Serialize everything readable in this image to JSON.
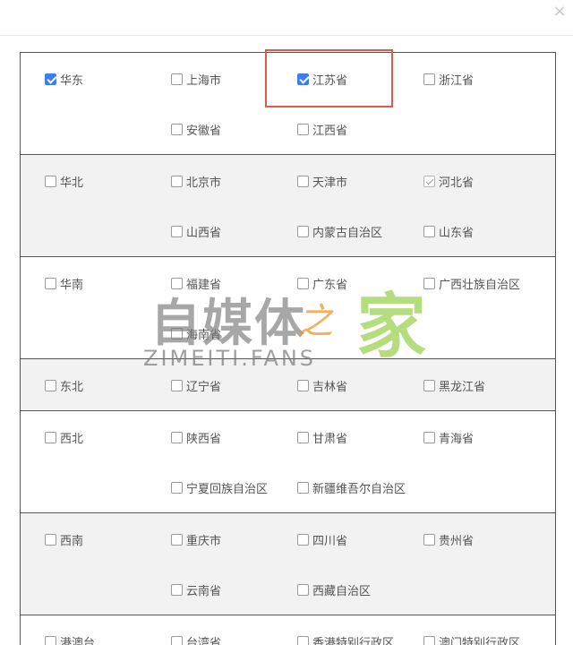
{
  "dialog": {
    "close_symbol": "×"
  },
  "regions": [
    {
      "name": "华东",
      "state": "checked",
      "provinces": [
        {
          "name": "上海市",
          "state": "unchecked"
        },
        {
          "name": "江苏省",
          "state": "checked"
        },
        {
          "name": "浙江省",
          "state": "unchecked"
        },
        {
          "name": "安徽省",
          "state": "unchecked"
        },
        {
          "name": "江西省",
          "state": "unchecked"
        }
      ]
    },
    {
      "name": "华北",
      "state": "unchecked",
      "provinces": [
        {
          "name": "北京市",
          "state": "unchecked"
        },
        {
          "name": "天津市",
          "state": "unchecked"
        },
        {
          "name": "河北省",
          "state": "partial"
        },
        {
          "name": "山西省",
          "state": "unchecked"
        },
        {
          "name": "内蒙古自治区",
          "state": "unchecked"
        },
        {
          "name": "山东省",
          "state": "unchecked"
        }
      ]
    },
    {
      "name": "华南",
      "state": "unchecked",
      "provinces": [
        {
          "name": "福建省",
          "state": "unchecked"
        },
        {
          "name": "广东省",
          "state": "unchecked"
        },
        {
          "name": "广西壮族自治区",
          "state": "unchecked"
        },
        {
          "name": "海南省",
          "state": "unchecked"
        }
      ]
    },
    {
      "name": "东北",
      "state": "unchecked",
      "provinces": [
        {
          "name": "辽宁省",
          "state": "unchecked"
        },
        {
          "name": "吉林省",
          "state": "unchecked"
        },
        {
          "name": "黑龙江省",
          "state": "unchecked"
        }
      ]
    },
    {
      "name": "西北",
      "state": "unchecked",
      "provinces": [
        {
          "name": "陕西省",
          "state": "unchecked"
        },
        {
          "name": "甘肃省",
          "state": "unchecked"
        },
        {
          "name": "青海省",
          "state": "unchecked"
        },
        {
          "name": "宁夏回族自治区",
          "state": "unchecked"
        },
        {
          "name": "新疆维吾尔自治区",
          "state": "unchecked"
        }
      ]
    },
    {
      "name": "西南",
      "state": "unchecked",
      "provinces": [
        {
          "name": "重庆市",
          "state": "unchecked"
        },
        {
          "name": "四川省",
          "state": "unchecked"
        },
        {
          "name": "贵州省",
          "state": "unchecked"
        },
        {
          "name": "云南省",
          "state": "unchecked"
        },
        {
          "name": "西藏自治区",
          "state": "unchecked"
        }
      ]
    },
    {
      "name": "港澳台",
      "state": "unchecked",
      "provinces": [
        {
          "name": "台湾省",
          "state": "unchecked"
        },
        {
          "name": "香港特别行政区",
          "state": "unchecked"
        },
        {
          "name": "澳门特别行政区",
          "state": "unchecked"
        }
      ]
    }
  ],
  "watermark": {
    "main": "自媒体",
    "zhi": "之",
    "jia": "家",
    "sub": "ZIMEITI.FANS"
  },
  "colors": {
    "checked": "#3d7df0",
    "highlight": "#e05a4a",
    "border": "#555555",
    "alt_row": "#f2f2f2"
  }
}
